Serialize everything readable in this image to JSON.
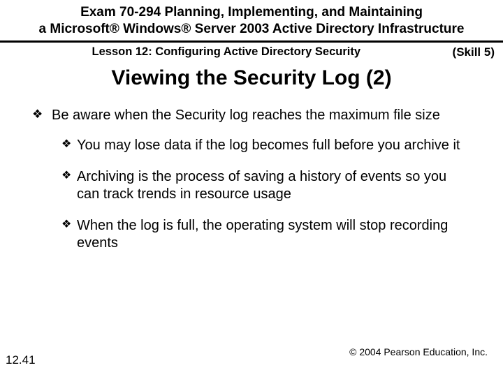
{
  "header": {
    "line1": "Exam 70-294 Planning, Implementing, and Maintaining",
    "line2": "a Microsoft® Windows® Server 2003 Active Directory Infrastructure"
  },
  "lesson": "Lesson 12: Configuring Active Directory Security",
  "skill": "(Skill 5)",
  "title": "Viewing the Security Log (2)",
  "bullets": {
    "main": "Be aware when the Security log reaches the maximum file size",
    "sub1": "You may lose data if the log becomes full before you archive it",
    "sub2": "Archiving is the process of saving a history of events so you can track trends in resource usage",
    "sub3": "When the log is full, the operating system will stop recording events"
  },
  "page_number": "12.41",
  "copyright": "© 2004 Pearson Education, Inc."
}
